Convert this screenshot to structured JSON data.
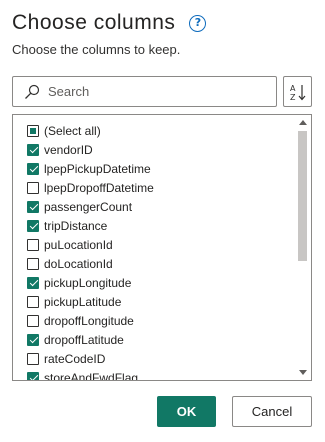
{
  "dialog": {
    "title": "Choose columns",
    "help_icon_glyph": "?",
    "subtitle": "Choose the columns to keep.",
    "search": {
      "placeholder": "Search",
      "value": ""
    },
    "sort_icon": "sort-az-icon",
    "select_all": {
      "label": "(Select all)",
      "state": "indeterminate"
    },
    "columns": [
      {
        "label": "vendorID",
        "checked": true
      },
      {
        "label": "lpepPickupDatetime",
        "checked": true
      },
      {
        "label": "lpepDropoffDatetime",
        "checked": false
      },
      {
        "label": "passengerCount",
        "checked": true
      },
      {
        "label": "tripDistance",
        "checked": true
      },
      {
        "label": "puLocationId",
        "checked": false
      },
      {
        "label": "doLocationId",
        "checked": false
      },
      {
        "label": "pickupLongitude",
        "checked": true
      },
      {
        "label": "pickupLatitude",
        "checked": false
      },
      {
        "label": "dropoffLongitude",
        "checked": false
      },
      {
        "label": "dropoffLatitude",
        "checked": true
      },
      {
        "label": "rateCodeID",
        "checked": false
      },
      {
        "label": "storeAndFwdFlag",
        "checked": true
      }
    ],
    "ok_label": "OK",
    "cancel_label": "Cancel",
    "colors": {
      "accent": "#117865",
      "help": "#0f6cbd",
      "border": "#8a8886"
    }
  }
}
